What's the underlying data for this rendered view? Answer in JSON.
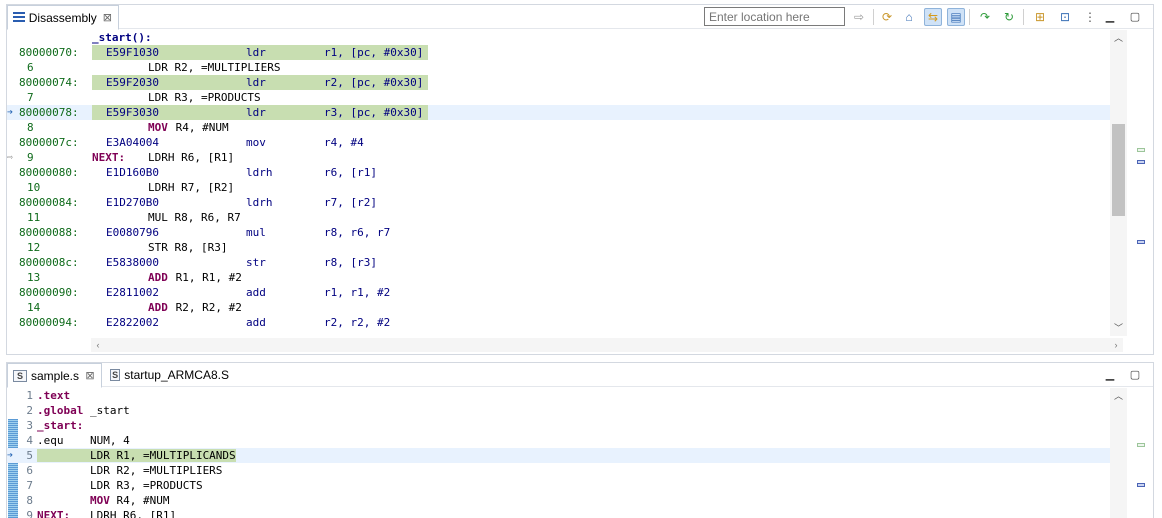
{
  "top_view": {
    "tab_label": "Disassembly",
    "tab_close": "⊠",
    "location_placeholder": "Enter location here",
    "toolbar_icons": [
      "go-icon",
      "refresh-icon",
      "home-icon",
      "link-with-debug-icon",
      "show-source-icon",
      "step-over-icon",
      "step-into-icon",
      "new-view-icon",
      "pin-icon",
      "view-menu-icon"
    ],
    "label_start": "_start():",
    "lines": [
      {
        "kind": "asm",
        "addr": "80000070:",
        "hex": "E59F1030",
        "mn": "ldr",
        "ops": "r1, [pc, #0x30]",
        "hl": true
      },
      {
        "kind": "src",
        "num": "6",
        "src": "LDR R2, =MULTIPLIERS",
        "kw": false
      },
      {
        "kind": "asm",
        "addr": "80000074:",
        "hex": "E59F2030",
        "mn": "ldr",
        "ops": "r2, [pc, #0x30]",
        "hl": true
      },
      {
        "kind": "src",
        "num": "7",
        "src": "LDR R3, =PRODUCTS",
        "kw": false
      },
      {
        "kind": "asm",
        "addr": "80000078:",
        "hex": "E59F3030",
        "mn": "ldr",
        "ops": "r3, [pc, #0x30]",
        "hl": true,
        "current": true
      },
      {
        "kind": "src",
        "num": "8",
        "kwtxt": "MOV",
        "rest": " R4, #NUM",
        "kw": true
      },
      {
        "kind": "asm",
        "addr": "8000007c:",
        "hex": "E3A04004",
        "mn": "mov",
        "ops": "r4, #4"
      },
      {
        "kind": "srclbl",
        "num": "9",
        "label": "NEXT:",
        "src": "LDRH R6, [R1]"
      },
      {
        "kind": "asm",
        "addr": "80000080:",
        "hex": "E1D160B0",
        "mn": "ldrh",
        "ops": "r6, [r1]"
      },
      {
        "kind": "src",
        "num": "10",
        "src": "LDRH R7, [R2]",
        "kw": false
      },
      {
        "kind": "asm",
        "addr": "80000084:",
        "hex": "E1D270B0",
        "mn": "ldrh",
        "ops": "r7, [r2]"
      },
      {
        "kind": "src",
        "num": "11",
        "src": "MUL R8, R6, R7",
        "kw": false
      },
      {
        "kind": "asm",
        "addr": "80000088:",
        "hex": "E0080796",
        "mn": "mul",
        "ops": "r8, r6, r7"
      },
      {
        "kind": "src",
        "num": "12",
        "src": "STR R8, [R3]",
        "kw": false
      },
      {
        "kind": "asm",
        "addr": "8000008c:",
        "hex": "E5838000",
        "mn": "str",
        "ops": "r8, [r3]"
      },
      {
        "kind": "src",
        "num": "13",
        "kwtxt": "ADD",
        "rest": " R1, R1, #2",
        "kw": true
      },
      {
        "kind": "asm",
        "addr": "80000090:",
        "hex": "E2811002",
        "mn": "add",
        "ops": "r1, r1, #2"
      },
      {
        "kind": "src",
        "num": "14",
        "kwtxt": "ADD",
        "rest": " R2, R2, #2",
        "kw": true
      },
      {
        "kind": "asm",
        "addr": "80000094:",
        "hex": "E2822002",
        "mn": "add",
        "ops": "r2, r2, #2"
      }
    ]
  },
  "bottom_view": {
    "tabs": [
      {
        "label": "sample.s",
        "close": "⊠",
        "icon_text": "S"
      },
      {
        "label": "startup_ARMCA8.S",
        "icon_text": "S"
      }
    ],
    "lines": [
      {
        "n": "1",
        "parts": [
          {
            "t": ".text",
            "c": "dir"
          }
        ]
      },
      {
        "n": "2",
        "parts": [
          {
            "t": ".global",
            "c": "dir"
          },
          {
            "t": " _start",
            "c": ""
          }
        ]
      },
      {
        "n": "3",
        "parts": [
          {
            "t": "_start:",
            "c": "lbl"
          }
        ]
      },
      {
        "n": "4",
        "parts": [
          {
            "t": ".equ",
            "c": ""
          },
          {
            "t": "    NUM, 4",
            "c": ""
          }
        ]
      },
      {
        "n": "5",
        "parts": [
          {
            "t": "        LDR R1, =MULTIPLICANDS",
            "c": ""
          }
        ],
        "current": true
      },
      {
        "n": "6",
        "parts": [
          {
            "t": "        LDR R2, =MULTIPLIERS",
            "c": ""
          }
        ]
      },
      {
        "n": "7",
        "parts": [
          {
            "t": "        LDR R3, =PRODUCTS",
            "c": ""
          }
        ]
      },
      {
        "n": "8",
        "parts": [
          {
            "t": "        ",
            "c": ""
          },
          {
            "t": "MOV",
            "c": "kw"
          },
          {
            "t": " R4, #NUM",
            "c": ""
          }
        ]
      },
      {
        "n": "9",
        "parts": [
          {
            "t": "NEXT:",
            "c": "lbl"
          },
          {
            "t": "   LDRH R6, [R1]",
            "c": ""
          }
        ]
      }
    ]
  }
}
